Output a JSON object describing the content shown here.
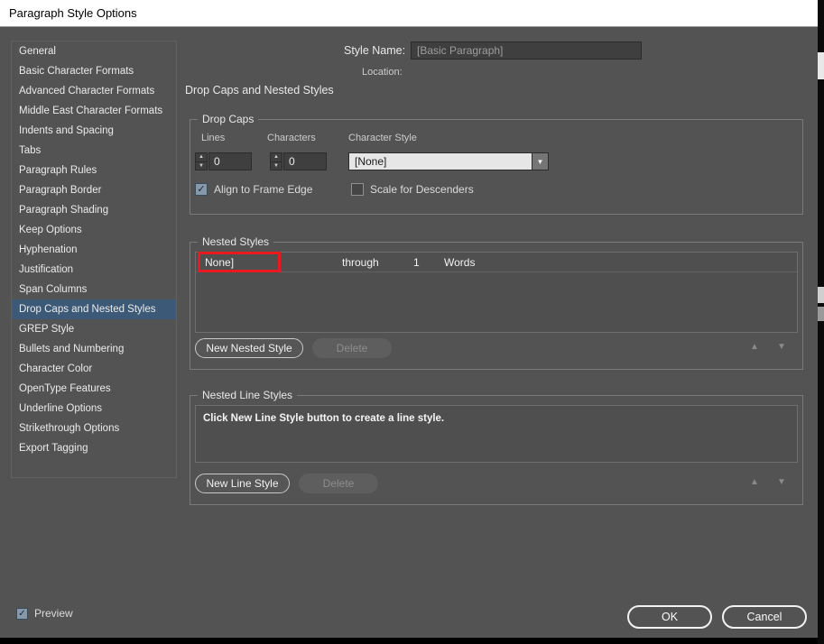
{
  "window": {
    "title": "Paragraph Style Options"
  },
  "sidebar": {
    "items": [
      "General",
      "Basic Character Formats",
      "Advanced Character Formats",
      "Middle East Character Formats",
      "Indents and Spacing",
      "Tabs",
      "Paragraph Rules",
      "Paragraph Border",
      "Paragraph Shading",
      "Keep Options",
      "Hyphenation",
      "Justification",
      "Span Columns",
      "Drop Caps and Nested Styles",
      "GREP Style",
      "Bullets and Numbering",
      "Character Color",
      "OpenType Features",
      "Underline Options",
      "Strikethrough Options",
      "Export Tagging"
    ],
    "selected": "Drop Caps and Nested Styles"
  },
  "header": {
    "style_name_label": "Style Name:",
    "style_name_value": "[Basic Paragraph]",
    "location_label": "Location:",
    "panel_title": "Drop Caps and Nested Styles"
  },
  "drop_caps": {
    "title": "Drop Caps",
    "lines_label": "Lines",
    "lines_value": "0",
    "characters_label": "Characters",
    "characters_value": "0",
    "character_style_label": "Character Style",
    "character_style_value": "[None]",
    "align_to_frame_edge": {
      "label": "Align to Frame Edge",
      "checked": true
    },
    "scale_for_descenders": {
      "label": "Scale for Descenders",
      "checked": false
    }
  },
  "nested_styles": {
    "title": "Nested Styles",
    "row": {
      "style": "None]",
      "through": "through",
      "count": "1",
      "unit": "Words"
    },
    "new_button": "New Nested Style",
    "delete_button": "Delete",
    "annotation": {
      "type": "red-highlight-box",
      "color": "#e8191f"
    }
  },
  "nested_line_styles": {
    "title": "Nested Line Styles",
    "placeholder": "Click New Line Style button to create a line style.",
    "new_button": "New Line Style",
    "delete_button": "Delete"
  },
  "footer": {
    "preview": {
      "label": "Preview",
      "checked": true
    },
    "ok": "OK",
    "cancel": "Cancel"
  },
  "icons": {
    "check": "✓",
    "stepper_up": "▲",
    "stepper_down": "▼",
    "dropdown_arrow": "▼",
    "move_up": "▲",
    "move_down": "▼"
  },
  "colors": {
    "titlebar_bg": "#ffffff",
    "dialog_bg": "#535353",
    "selected_item_bg": "#3c5a77",
    "field_bg": "#3f3f3f",
    "dropdown_bg": "#e6e6e6",
    "annotation_red": "#e8191f"
  }
}
